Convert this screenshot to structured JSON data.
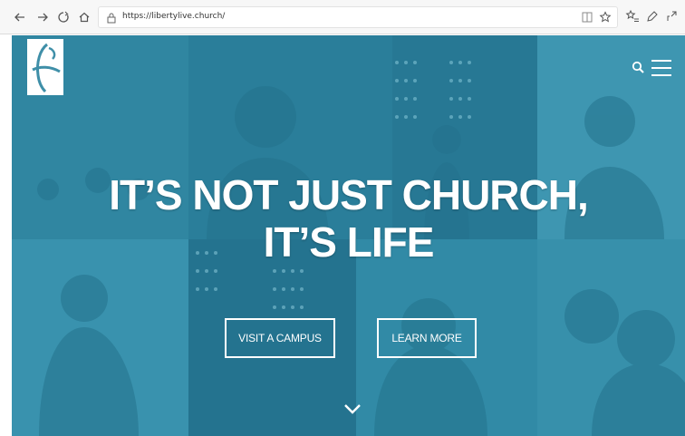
{
  "browser": {
    "url": "https://libertylive.church/",
    "icons": [
      "back-icon",
      "forward-icon",
      "refresh-icon",
      "home-icon",
      "lock-icon",
      "reading-view-icon",
      "favorite-star-icon",
      "favorites-icon",
      "pen-icon",
      "share-icon"
    ]
  },
  "site": {
    "headline_line1": "IT’S NOT JUST CHURCH,",
    "headline_line2": "IT’S LIFE",
    "buttons": {
      "visit_label": "VISIT A CAMPUS",
      "learn_label": "LEARN MORE"
    },
    "icons": [
      "logo",
      "search-icon",
      "menu-icon",
      "chevron-down-icon"
    ]
  },
  "colors": {
    "overlay": "#3f8fa8",
    "text": "#ffffff"
  }
}
